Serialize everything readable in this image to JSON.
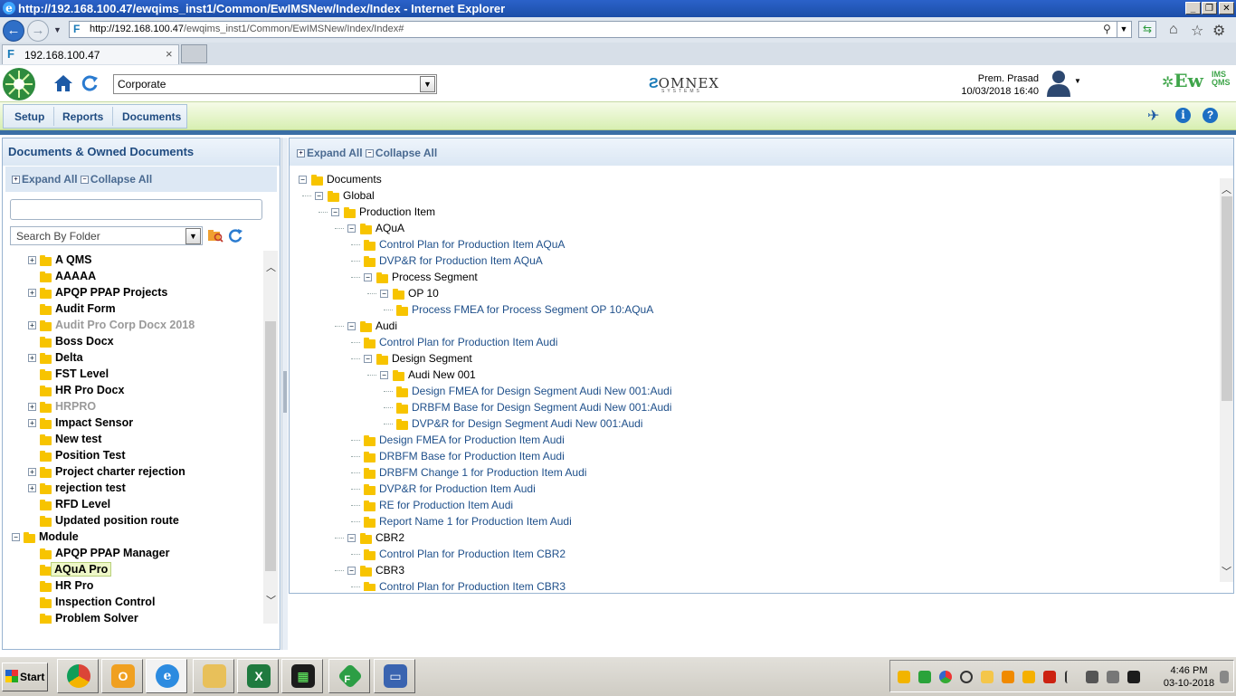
{
  "window": {
    "title": "http://192.168.100.47/ewqims_inst1/Common/EwIMSNew/Index/Index - Internet Explorer",
    "minimize": "_",
    "maximize": "❐",
    "close": "✕"
  },
  "browser": {
    "url_host": "http://192.168.100.47",
    "url_path": "/ewqims_inst1/Common/EwIMSNew/Index/Index#",
    "tab_title": "192.168.100.47",
    "tab_close": "×"
  },
  "app": {
    "company_select": "Corporate",
    "brand_center": "OMNEX",
    "brand_center_sub": "SYSTEMS",
    "user_name": "Prem. Prasad",
    "datetime": "10/03/2018 16:40",
    "brand_right": "Ew",
    "brand_right_sub_top": "IMS",
    "brand_right_sub_bottom": "QMS"
  },
  "menu": {
    "setup": "Setup",
    "reports": "Reports",
    "documents": "Documents"
  },
  "left_panel": {
    "title": "Documents & Owned Documents",
    "expand_all": "Expand All",
    "collapse_all": "Collapse All",
    "search_by": "Search By Folder",
    "tree": [
      {
        "label": "A QMS",
        "indent": 1,
        "toggle": "+",
        "grey": false,
        "selected": false
      },
      {
        "label": "AAAAA",
        "indent": 1,
        "toggle": "",
        "grey": false,
        "selected": false
      },
      {
        "label": "APQP PPAP Projects",
        "indent": 1,
        "toggle": "+",
        "grey": false,
        "selected": false
      },
      {
        "label": "Audit Form",
        "indent": 1,
        "toggle": "",
        "grey": false,
        "selected": false
      },
      {
        "label": "Audit Pro Corp Docx 2018",
        "indent": 1,
        "toggle": "+",
        "grey": true,
        "selected": false
      },
      {
        "label": "Boss Docx",
        "indent": 1,
        "toggle": "",
        "grey": false,
        "selected": false
      },
      {
        "label": "Delta",
        "indent": 1,
        "toggle": "+",
        "grey": false,
        "selected": false
      },
      {
        "label": "FST Level",
        "indent": 1,
        "toggle": "",
        "grey": false,
        "selected": false
      },
      {
        "label": "HR Pro Docx",
        "indent": 1,
        "toggle": "",
        "grey": false,
        "selected": false
      },
      {
        "label": "HRPRO",
        "indent": 1,
        "toggle": "+",
        "grey": true,
        "selected": false
      },
      {
        "label": "Impact Sensor",
        "indent": 1,
        "toggle": "+",
        "grey": false,
        "selected": false
      },
      {
        "label": "New test",
        "indent": 1,
        "toggle": "",
        "grey": false,
        "selected": false
      },
      {
        "label": "Position Test",
        "indent": 1,
        "toggle": "",
        "grey": false,
        "selected": false
      },
      {
        "label": "Project charter rejection",
        "indent": 1,
        "toggle": "+",
        "grey": false,
        "selected": false
      },
      {
        "label": "rejection test",
        "indent": 1,
        "toggle": "+",
        "grey": false,
        "selected": false
      },
      {
        "label": "RFD Level",
        "indent": 1,
        "toggle": "",
        "grey": false,
        "selected": false
      },
      {
        "label": "Updated position route",
        "indent": 1,
        "toggle": "",
        "grey": false,
        "selected": false
      },
      {
        "label": "Module",
        "indent": 0,
        "toggle": "−",
        "grey": false,
        "selected": false
      },
      {
        "label": "APQP PPAP Manager",
        "indent": 1,
        "toggle": "",
        "grey": false,
        "selected": false
      },
      {
        "label": "AQuA Pro",
        "indent": 1,
        "toggle": "",
        "grey": false,
        "selected": true
      },
      {
        "label": "HR Pro",
        "indent": 1,
        "toggle": "",
        "grey": false,
        "selected": false
      },
      {
        "label": "Inspection Control",
        "indent": 1,
        "toggle": "",
        "grey": false,
        "selected": false
      },
      {
        "label": "Problem Solver",
        "indent": 1,
        "toggle": "",
        "grey": false,
        "selected": false
      }
    ]
  },
  "right_panel": {
    "expand_all": "Expand All",
    "collapse_all": "Collapse All",
    "tree": [
      {
        "label": "Documents",
        "indent": 0,
        "toggle": "−",
        "link": false
      },
      {
        "label": "Global",
        "indent": 1,
        "toggle": "−",
        "link": false
      },
      {
        "label": "Production Item",
        "indent": 2,
        "toggle": "−",
        "link": false
      },
      {
        "label": "AQuA",
        "indent": 3,
        "toggle": "−",
        "link": false
      },
      {
        "label": "Control Plan for Production Item AQuA",
        "indent": 4,
        "toggle": "",
        "link": true
      },
      {
        "label": "DVP&R for Production Item AQuA",
        "indent": 4,
        "toggle": "",
        "link": true
      },
      {
        "label": "Process Segment",
        "indent": 4,
        "toggle": "−",
        "link": false
      },
      {
        "label": "OP 10",
        "indent": 5,
        "toggle": "−",
        "link": false
      },
      {
        "label": "Process FMEA for Process Segment OP 10:AQuA",
        "indent": 6,
        "toggle": "",
        "link": true
      },
      {
        "label": "Audi",
        "indent": 3,
        "toggle": "−",
        "link": false
      },
      {
        "label": "Control Plan for Production Item Audi",
        "indent": 4,
        "toggle": "",
        "link": true
      },
      {
        "label": "Design Segment",
        "indent": 4,
        "toggle": "−",
        "link": false
      },
      {
        "label": "Audi New 001",
        "indent": 5,
        "toggle": "−",
        "link": false
      },
      {
        "label": "Design FMEA for Design Segment Audi New 001:Audi",
        "indent": 6,
        "toggle": "",
        "link": true
      },
      {
        "label": "DRBFM Base for Design Segment Audi New 001:Audi",
        "indent": 6,
        "toggle": "",
        "link": true
      },
      {
        "label": "DVP&R for Design Segment Audi New 001:Audi",
        "indent": 6,
        "toggle": "",
        "link": true
      },
      {
        "label": "Design FMEA for Production Item Audi",
        "indent": 4,
        "toggle": "",
        "link": true
      },
      {
        "label": "DRBFM Base for Production Item Audi",
        "indent": 4,
        "toggle": "",
        "link": true
      },
      {
        "label": "DRBFM Change 1 for Production Item Audi",
        "indent": 4,
        "toggle": "",
        "link": true
      },
      {
        "label": "DVP&R for Production Item Audi",
        "indent": 4,
        "toggle": "",
        "link": true
      },
      {
        "label": "RE for Production Item Audi",
        "indent": 4,
        "toggle": "",
        "link": true
      },
      {
        "label": "Report Name 1 for Production Item Audi",
        "indent": 4,
        "toggle": "",
        "link": true
      },
      {
        "label": "CBR2",
        "indent": 3,
        "toggle": "−",
        "link": false
      },
      {
        "label": "Control Plan for Production Item CBR2",
        "indent": 4,
        "toggle": "",
        "link": true
      },
      {
        "label": "CBR3",
        "indent": 3,
        "toggle": "−",
        "link": false
      },
      {
        "label": "Control Plan for Production Item CBR3",
        "indent": 4,
        "toggle": "",
        "link": true
      }
    ]
  },
  "taskbar": {
    "start": "Start",
    "time": "4:46 PM",
    "date": "03-10-2018"
  },
  "colors": {
    "link": "#1e4f8a",
    "folder": "#f7c400",
    "menubar": "#d7efb2",
    "panel_header": "#1f4b80",
    "selected_bg": "#eef7c8"
  }
}
